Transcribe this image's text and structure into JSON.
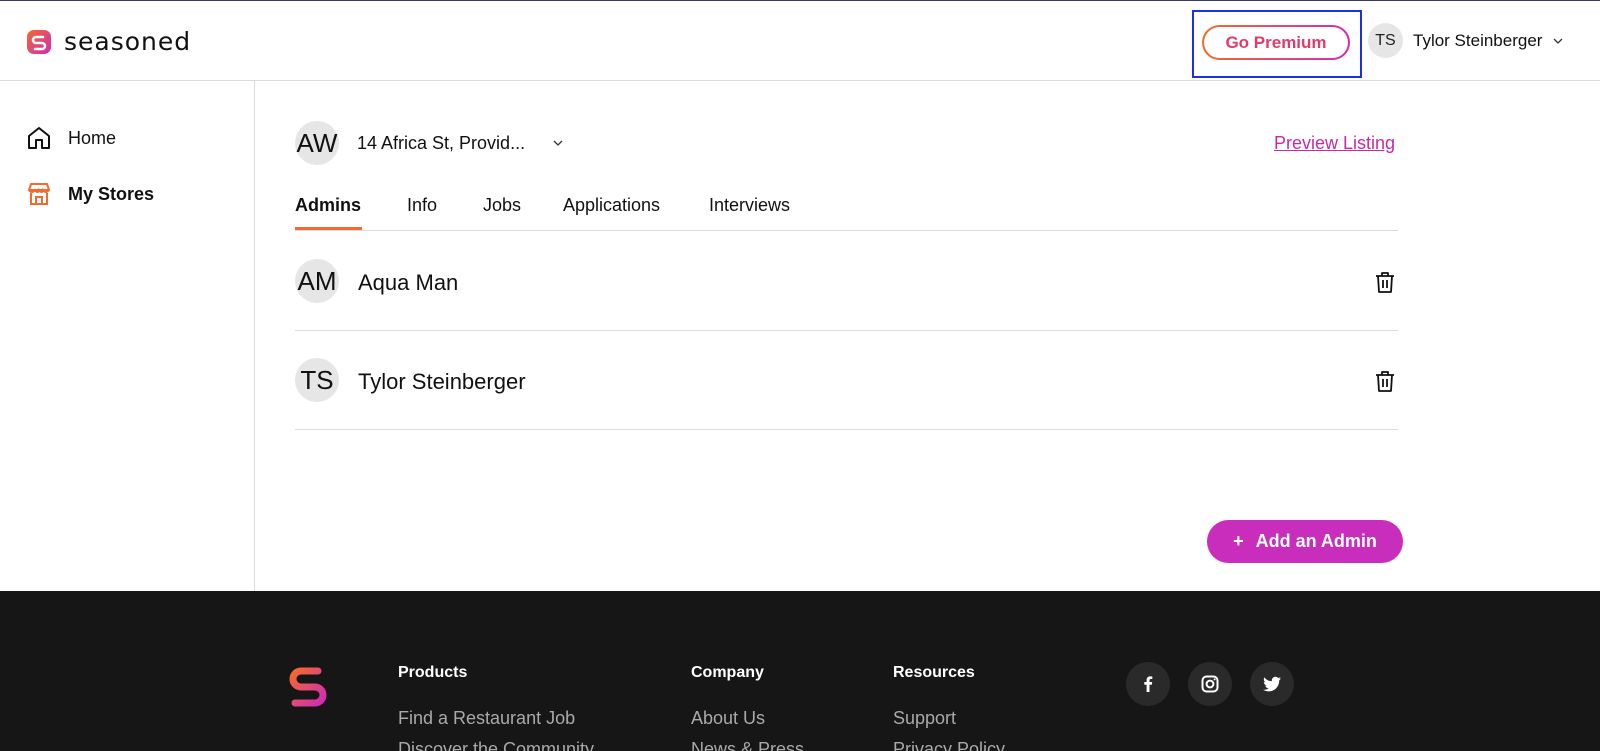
{
  "brand": {
    "name": "seasoned"
  },
  "header": {
    "premium_label": "Go Premium",
    "user": {
      "initials": "TS",
      "name": "Tylor Steinberger"
    }
  },
  "sidebar": {
    "items": [
      {
        "label": "Home",
        "icon": "home-icon"
      },
      {
        "label": "My Stores",
        "icon": "store-icon",
        "active": true
      }
    ]
  },
  "store": {
    "initials": "AW",
    "name": "14 Africa St, Provid...",
    "preview_label": "Preview Listing"
  },
  "tabs": [
    {
      "label": "Admins",
      "active": true
    },
    {
      "label": "Info"
    },
    {
      "label": "Jobs"
    },
    {
      "label": "Applications"
    },
    {
      "label": "Interviews"
    }
  ],
  "admins": [
    {
      "initials": "AM",
      "name": "Aqua Man"
    },
    {
      "initials": "TS",
      "name": "Tylor Steinberger"
    }
  ],
  "add_admin": {
    "icon": "+",
    "label": "Add an Admin"
  },
  "footer": {
    "columns": [
      {
        "heading": "Products",
        "links": [
          "Find a Restaurant Job",
          "Discover the Community"
        ]
      },
      {
        "heading": "Company",
        "links": [
          "About Us",
          "News & Press"
        ]
      },
      {
        "heading": "Resources",
        "links": [
          "Support",
          "Privacy Policy"
        ]
      }
    ],
    "social": [
      "facebook-icon",
      "instagram-icon",
      "twitter-icon"
    ]
  },
  "colors": {
    "accent_orange": "#f26a2e",
    "accent_magenta": "#c82dbc",
    "highlight_blue": "#1d2fe0",
    "footer_bg": "#171617"
  }
}
